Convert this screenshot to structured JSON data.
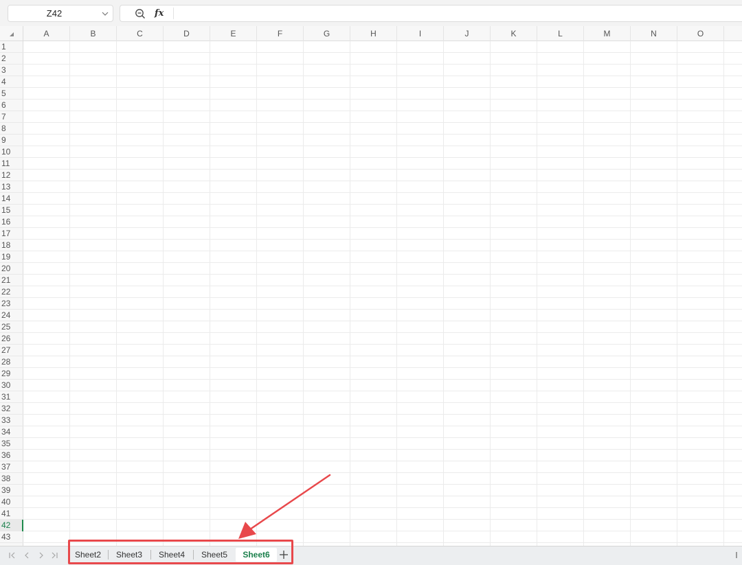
{
  "formula_bar": {
    "name_box_value": "Z42",
    "formula_value": "",
    "fx_label": "fx",
    "icons": {
      "name_box_dropdown": "chevron-down-icon",
      "zoom_formula": "zoom-out-icon",
      "function": "fx-icon"
    }
  },
  "grid": {
    "columns": [
      "A",
      "B",
      "C",
      "D",
      "E",
      "F",
      "G",
      "H",
      "I",
      "J",
      "K",
      "L",
      "M",
      "N",
      "O"
    ],
    "rows": [
      "1",
      "2",
      "3",
      "4",
      "5",
      "6",
      "7",
      "8",
      "9",
      "10",
      "11",
      "12",
      "13",
      "14",
      "15",
      "16",
      "17",
      "18",
      "19",
      "20",
      "21",
      "22",
      "23",
      "24",
      "25",
      "26",
      "27",
      "28",
      "29",
      "30",
      "31",
      "32",
      "33",
      "34",
      "35",
      "36",
      "37",
      "38",
      "39",
      "40",
      "41",
      "42",
      "43"
    ],
    "selected_row": "42",
    "select_all_icon": "select-all-triangle-icon"
  },
  "tab_bar": {
    "nav_icons": [
      "first-sheet-icon",
      "previous-sheet-icon",
      "next-sheet-icon",
      "last-sheet-icon"
    ],
    "sheets": [
      {
        "label": "Sheet2",
        "active": false
      },
      {
        "label": "Sheet3",
        "active": false
      },
      {
        "label": "Sheet4",
        "active": false
      },
      {
        "label": "Sheet5",
        "active": false
      },
      {
        "label": "Sheet6",
        "active": true
      }
    ],
    "add_sheet_icon": "plus-icon"
  },
  "colors": {
    "accent_green": "#1a7f4b",
    "annotation_red": "#e8484b",
    "gridline": "#ebebeb"
  }
}
